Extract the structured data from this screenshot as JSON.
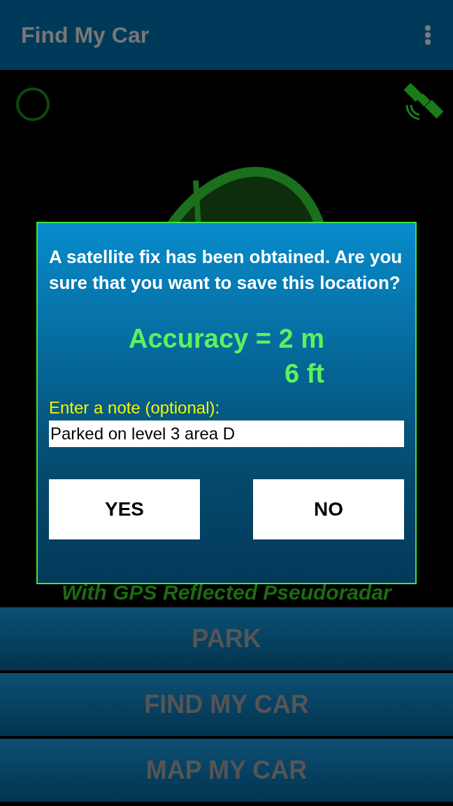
{
  "app_bar": {
    "title": "Find My Car"
  },
  "banner_text": "With GPS Reflected Pseudoradar",
  "dialog": {
    "message": "A satellite fix has been obtained. Are you sure that you want to save this location?",
    "accuracy_lines": [
      "Accuracy = 2 m",
      "6 ft"
    ],
    "note_label": "Enter a note (optional):",
    "note_value": "Parked on level 3 area D",
    "buttons": [
      "YES",
      "NO"
    ]
  },
  "actions": [
    "PARK",
    "FIND MY CAR",
    "MAP MY CAR"
  ]
}
